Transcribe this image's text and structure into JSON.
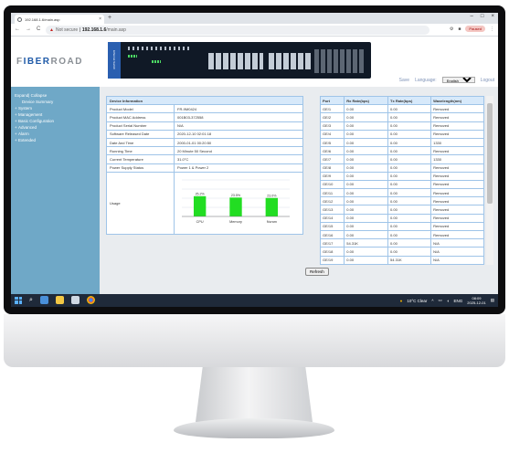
{
  "browser": {
    "tab_title": "192.168.1.6/main.asp",
    "tab_close": "×",
    "new_tab": "+",
    "window_controls": [
      "–",
      "□",
      "×"
    ],
    "not_secure": "Not secure",
    "url_host": "192.168.1.6",
    "url_path": "/main.asp",
    "profile_label": "Paused"
  },
  "header": {
    "logo_left": "F",
    "logo_accent": "IBER",
    "logo_right": "ROAD",
    "device_side_text": "Ethernet Switch",
    "save_label": "Save",
    "language_label": "Language:",
    "language_value": "English",
    "logout_label": "Logout"
  },
  "sidebar": {
    "expand_collapse": "Expand| Collapse",
    "items": [
      {
        "label": "Device Summary",
        "type": "sub"
      },
      {
        "label": "System",
        "type": "group"
      },
      {
        "label": "Management",
        "type": "group"
      },
      {
        "label": "Basic Configuration",
        "type": "group"
      },
      {
        "label": "Advanced",
        "type": "group"
      },
      {
        "label": "Alarm",
        "type": "group"
      },
      {
        "label": "Extended",
        "type": "group"
      }
    ]
  },
  "device_info": {
    "title": "Device Information",
    "rows": [
      {
        "label": "Product Model",
        "value": "FR-9M0424"
      },
      {
        "label": "Product MAC Address",
        "value": "001B03-372558"
      },
      {
        "label": "Product Serial Number",
        "value": "N/A"
      },
      {
        "label": "Software Released Date",
        "value": "2020-12-10 02:01:18"
      },
      {
        "label": "Date And Time",
        "value": "2000-01-01 00:20:50"
      },
      {
        "label": "Running Time",
        "value": "20 Minute 50 Second"
      },
      {
        "label": "Current Temperature",
        "value": "31.0°C"
      },
      {
        "label": "Power Supply Status",
        "value": "Power 1 & Power 2"
      }
    ],
    "usage_label": "Usage"
  },
  "chart_data": {
    "type": "bar",
    "categories": [
      "CPU",
      "Memory",
      "Nvram"
    ],
    "values": [
      25.2,
      23.5,
      23.0
    ],
    "data_labels": [
      "25.2%",
      "23.5%",
      "23.0%"
    ],
    "ylim": [
      0,
      100
    ],
    "bar_color": "#22dd22"
  },
  "ports": {
    "headers": [
      "Port",
      "Rx Rate(bps)",
      "Tx Rate(bps)",
      "Wavelength(nm)"
    ],
    "rows": [
      [
        "GE/1",
        "0.00",
        "0.00",
        "Removed"
      ],
      [
        "GE/2",
        "0.00",
        "0.00",
        "Removed"
      ],
      [
        "GE/3",
        "0.00",
        "0.00",
        "Removed"
      ],
      [
        "GE/4",
        "0.00",
        "0.00",
        "Removed"
      ],
      [
        "GE/5",
        "0.00",
        "0.00",
        "1330"
      ],
      [
        "GE/6",
        "0.00",
        "0.00",
        "Removed"
      ],
      [
        "GE/7",
        "0.00",
        "0.00",
        "1330"
      ],
      [
        "GE/8",
        "0.00",
        "0.00",
        "Removed"
      ],
      [
        "GE/9",
        "0.00",
        "0.00",
        "Removed"
      ],
      [
        "GE/10",
        "0.00",
        "0.00",
        "Removed"
      ],
      [
        "GE/11",
        "0.00",
        "0.00",
        "Removed"
      ],
      [
        "GE/12",
        "0.00",
        "0.00",
        "Removed"
      ],
      [
        "GE/13",
        "0.00",
        "0.00",
        "Removed"
      ],
      [
        "GE/14",
        "0.00",
        "0.00",
        "Removed"
      ],
      [
        "GE/15",
        "0.00",
        "0.00",
        "Removed"
      ],
      [
        "GE/16",
        "0.00",
        "0.00",
        "Removed"
      ],
      [
        "GE/17",
        "54.31K",
        "0.00",
        "N/A"
      ],
      [
        "GE/18",
        "0.00",
        "0.00",
        "N/A"
      ],
      [
        "GE/19",
        "0.00",
        "54.31K",
        "N/A"
      ],
      [
        "GE/20",
        "0.00",
        "0.00",
        "N/A"
      ]
    ],
    "refresh_label": "Refresh"
  },
  "taskbar": {
    "weather": "10°C  Clear",
    "language": "ENG",
    "time": "08:09",
    "date": "2025-12-01"
  }
}
